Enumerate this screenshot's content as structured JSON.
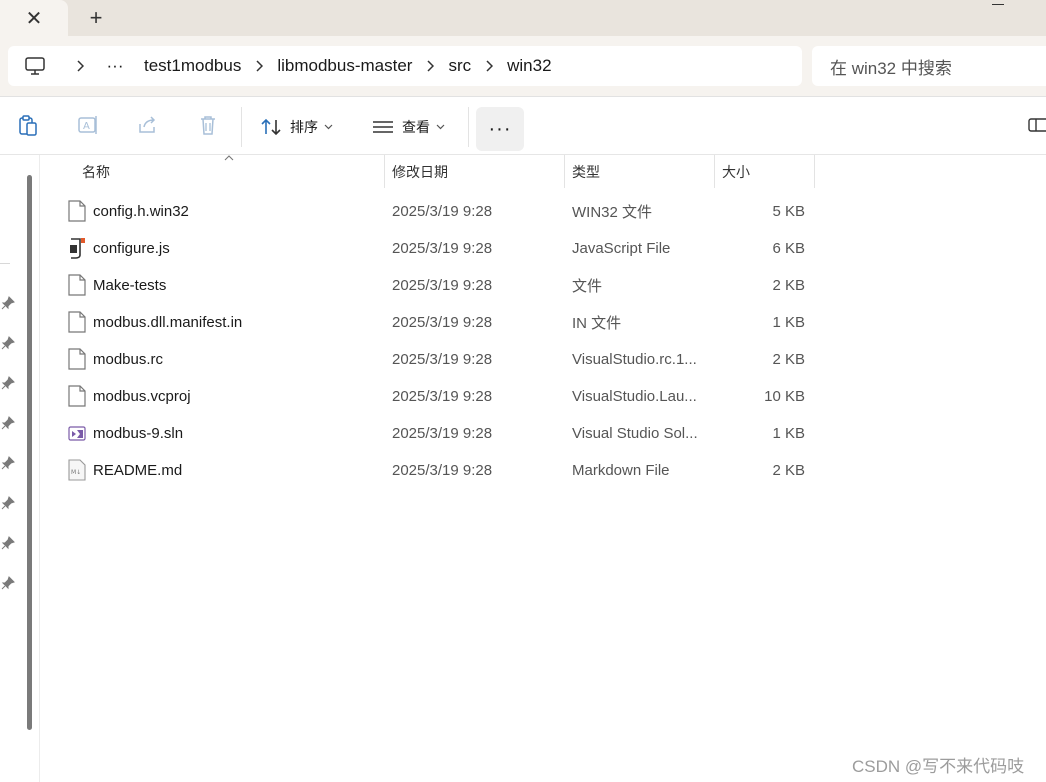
{
  "tabbar": {
    "close_glyph": "✕",
    "new_tab_glyph": "+"
  },
  "address": {
    "overflow": "···",
    "crumbs": [
      "test1modbus",
      "libmodbus-master",
      "src",
      "win32"
    ]
  },
  "search": {
    "placeholder": "在 win32 中搜索"
  },
  "toolbar": {
    "sort_label": "排序",
    "view_label": "查看",
    "more_label": "···"
  },
  "columns": {
    "name": "名称",
    "date": "修改日期",
    "type": "类型",
    "size": "大小"
  },
  "files": [
    {
      "name": "config.h.win32",
      "date": "2025/3/19 9:28",
      "type": "WIN32 文件",
      "size": "5 KB",
      "icon": "file-icon"
    },
    {
      "name": "configure.js",
      "date": "2025/3/19 9:28",
      "type": "JavaScript File",
      "size": "6 KB",
      "icon": "script-file-icon"
    },
    {
      "name": "Make-tests",
      "date": "2025/3/19 9:28",
      "type": "文件",
      "size": "2 KB",
      "icon": "file-icon"
    },
    {
      "name": "modbus.dll.manifest.in",
      "date": "2025/3/19 9:28",
      "type": "IN 文件",
      "size": "1 KB",
      "icon": "file-icon"
    },
    {
      "name": "modbus.rc",
      "date": "2025/3/19 9:28",
      "type": "VisualStudio.rc.1...",
      "size": "2 KB",
      "icon": "file-icon"
    },
    {
      "name": "modbus.vcproj",
      "date": "2025/3/19 9:28",
      "type": "VisualStudio.Lau...",
      "size": "10 KB",
      "icon": "file-icon"
    },
    {
      "name": "modbus-9.sln",
      "date": "2025/3/19 9:28",
      "type": "Visual Studio Sol...",
      "size": "1 KB",
      "icon": "visual-studio-solution-icon"
    },
    {
      "name": "README.md",
      "date": "2025/3/19 9:28",
      "type": "Markdown File",
      "size": "2 KB",
      "icon": "markdown-file-icon"
    }
  ],
  "watermark": "CSDN @写不来代码吱"
}
